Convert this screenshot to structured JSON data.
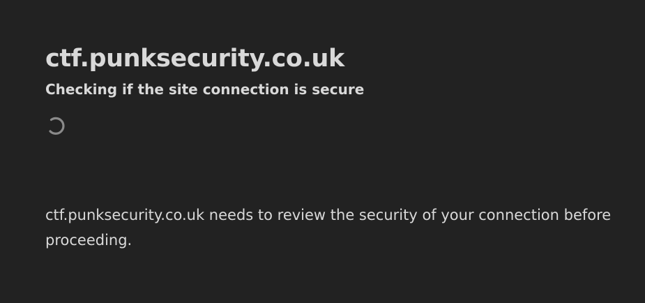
{
  "header": {
    "site_title": "ctf.punksecurity.co.uk",
    "subtitle": "Checking if the site connection is secure"
  },
  "spinner": {
    "icon": "loading-spinner-icon",
    "color": "#8a8a8a"
  },
  "body": {
    "review_text": "ctf.punksecurity.co.uk needs to review the security of your connection before proceeding."
  },
  "colors": {
    "background": "#222222",
    "text": "#d9d9d9"
  }
}
